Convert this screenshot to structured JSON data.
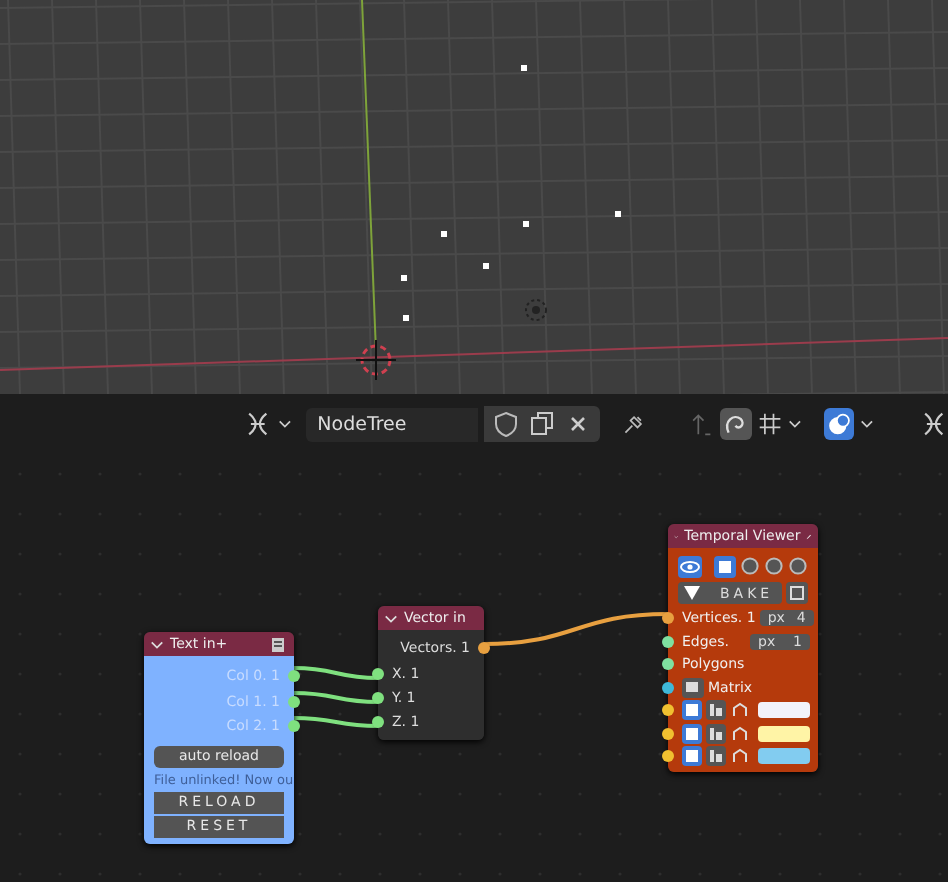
{
  "header": {
    "tree_name": "NodeTree"
  },
  "nodes": [
    {
      "kind": "text_in",
      "title": "Text in+",
      "outputs": [
        "Col 0. 1",
        "Col 1. 1",
        "Col 2. 1"
      ],
      "button": "auto reload",
      "note": "File unlinked! Now ou",
      "actions": [
        "RELOAD",
        "RESET"
      ]
    },
    {
      "kind": "vector_in",
      "title": "Vector in",
      "outputs": [
        "Vectors. 1"
      ],
      "inputs": [
        "X. 1",
        "Y. 1",
        "Z. 1"
      ]
    },
    {
      "kind": "viewer",
      "title": "Temporal Viewer",
      "bake": "BAKE",
      "inputs": [
        {
          "label": "Vertices. 1",
          "color": "#e8a040",
          "unit": "px",
          "value": "4"
        },
        {
          "label": "Edges.",
          "color": "#7fe0a0",
          "unit": "px",
          "value": "1"
        },
        {
          "label": "Polygons",
          "color": "#7fe0a0"
        },
        {
          "label": "Matrix",
          "color": "#3fb8d8"
        }
      ],
      "color_rows": [
        {
          "color": "#f2f2fa"
        },
        {
          "color": "#fff4a6"
        },
        {
          "color": "#82ccf0"
        }
      ]
    }
  ]
}
